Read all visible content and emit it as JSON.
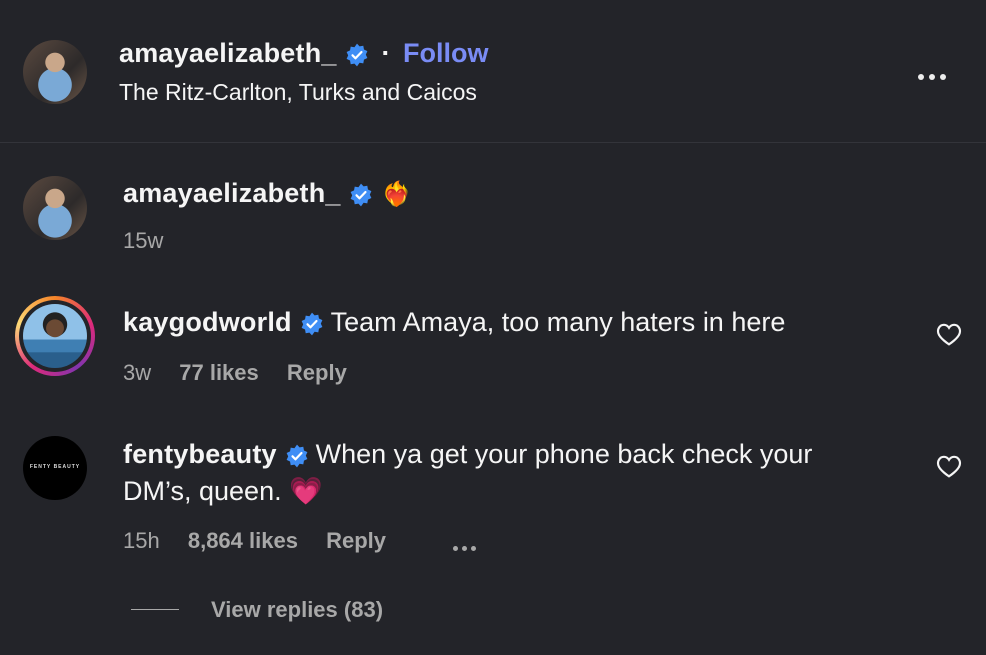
{
  "header": {
    "username": "amayaelizabeth_",
    "separator": "·",
    "follow_label": "Follow",
    "location": "The Ritz-Carlton, Turks and Caicos"
  },
  "caption": {
    "username": "amayaelizabeth_",
    "text": "❤️‍🔥",
    "time": "15w"
  },
  "comments": [
    {
      "username": "kaygodworld",
      "text": "Team Amaya, too many haters in here",
      "time": "3w",
      "likes": "77 likes",
      "reply_label": "Reply"
    },
    {
      "username": "fentybeauty",
      "text_line1": "When ya get your phone back check your",
      "text_line2": "DM’s, queen. 💗",
      "avatar_text": "FENTY BEAUTY",
      "time": "15h",
      "likes": "8,864 likes",
      "reply_label": "Reply"
    }
  ],
  "view_replies": "View replies (83)",
  "colors": {
    "background": "#232429",
    "verified": "#3f8ef5",
    "follow": "#7a8cf5",
    "muted": "#a8a8a8"
  },
  "icons": [
    "verified-badge-icon",
    "more-options-icon",
    "heart-icon",
    "story-ring"
  ]
}
